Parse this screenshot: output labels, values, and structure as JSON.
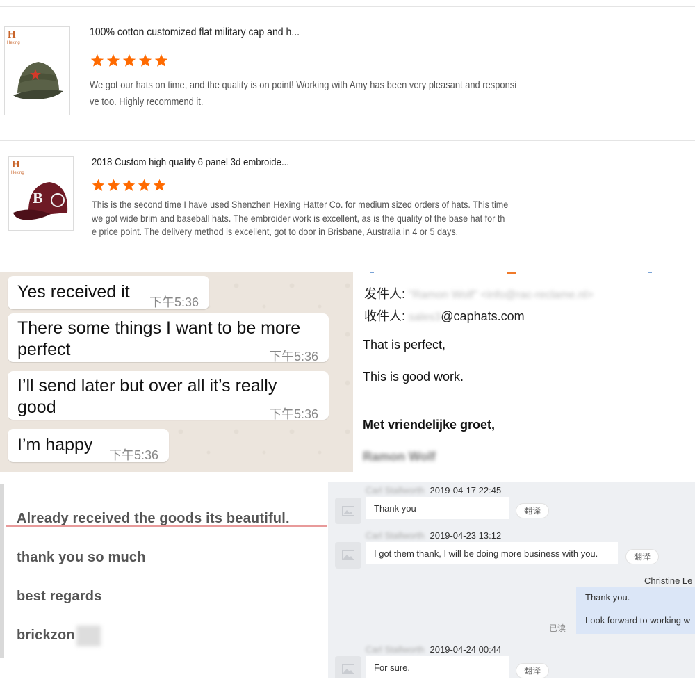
{
  "colors": {
    "star": "#ff6a00",
    "review_text": "#555555",
    "chat_bg": "#eef0f3",
    "sent_bubble": "#dbe6f7",
    "wa_bg": "#ece5dd"
  },
  "reviews": [
    {
      "logo": "H",
      "logo_sub": "Hexing",
      "title": "100% cotton customized flat military cap and h...",
      "rating": 5,
      "text_lines": [
        "We got our hats on time, and the quality is on point! Working with Amy has been very pleasant and responsi",
        "ve too. Highly recommend it."
      ]
    },
    {
      "logo": "H",
      "logo_sub": "Hexing",
      "title": "2018 Custom high quality 6 panel 3d embroide...",
      "rating": 5,
      "text_lines": [
        "This is the second time I have used Shenzhen Hexing Hatter Co. for medium sized orders of hats. This time",
        "we got wide brim and baseball hats. The embroider work is excellent, as is the quality of the base hat for th",
        "e price point. The delivery method is excellent, got to door in Brisbane, Australia in 4 or 5 days."
      ]
    }
  ],
  "whatsapp": {
    "messages": [
      {
        "lines": [
          "Yes received it"
        ],
        "time": "下午5:36"
      },
      {
        "lines": [
          "There some things I want to be more",
          "perfect"
        ],
        "time": "下午5:36"
      },
      {
        "lines": [
          "I’ll send later but over all it’s really",
          "good"
        ],
        "time": "下午5:36"
      },
      {
        "lines": [
          "I’m happy"
        ],
        "time": "下午5:36"
      }
    ]
  },
  "email": {
    "from_label": "发件人:",
    "from_value": "\"Ramon Wolf\" <info@rac-reclame.nl>",
    "to_label": "收件人:",
    "to_user": "sales3",
    "to_domain": "@caphats.com",
    "body_lines": [
      "That is perfect,",
      "This is good work."
    ],
    "closing": "Met vriendelijke groet,",
    "signature": "Ramon Wolf"
  },
  "note": {
    "lines": [
      "Already received the goods its beautiful.",
      "thank you so much",
      "best regards",
      "brickzon"
    ]
  },
  "chat": {
    "incoming": [
      {
        "sender": "Carl Stallworth",
        "time": "2019-04-17 22:45",
        "text": "Thank you",
        "translate": "翻译"
      },
      {
        "sender": "Carl Stallworth",
        "time": "2019-04-23 13:12",
        "text": "I got them thank, I will be doing more business with you.",
        "translate": "翻译"
      },
      {
        "sender": "Carl Stallworth",
        "time": "2019-04-24 00:44",
        "text": "For sure.",
        "translate": "翻译"
      }
    ],
    "outgoing": {
      "sender": "Christine Le",
      "lines": [
        "Thank you.",
        "Look forward to working w"
      ],
      "read_label": "已读"
    }
  }
}
